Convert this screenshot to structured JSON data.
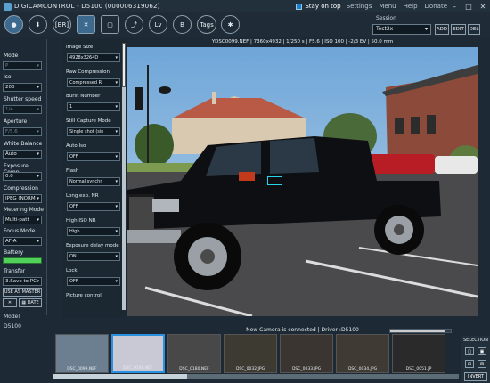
{
  "window": {
    "title": "DIGICAMCONTROL - D5100 (000006319062)",
    "stay_on_top": "Stay on top",
    "menu": [
      "Settings",
      "Menu",
      "Help",
      "Donate"
    ],
    "controls": [
      "–",
      "□",
      "✕"
    ]
  },
  "toolbar": {
    "buttons": [
      {
        "name": "capture-button",
        "label": "●"
      },
      {
        "name": "download-button",
        "label": "⬇"
      },
      {
        "name": "bracketing-button",
        "label": "[BR]"
      },
      {
        "name": "tools-button",
        "label": "✕"
      },
      {
        "name": "browse-button",
        "label": "▢"
      },
      {
        "name": "export-button",
        "label": "⤴"
      },
      {
        "name": "liveview-button",
        "label": "Lv"
      },
      {
        "name": "browser-button",
        "label": "B"
      },
      {
        "name": "tags-button",
        "label": "Tags"
      },
      {
        "name": "plugins-button",
        "label": "✱"
      }
    ],
    "session_label": "Session",
    "session_value": "Test2x",
    "session_buttons": [
      "ADD",
      "EDIT",
      "DEL"
    ]
  },
  "left_panel": {
    "mode_label": "Mode",
    "mode_value": "P",
    "iso_label": "Iso",
    "iso_value": "200",
    "shutter_label": "Shutter speed",
    "shutter_value": "1/4",
    "aperture_label": "Aperture",
    "aperture_value": "F/5.6",
    "wb_label": "White Balance",
    "wb_value": "Auto",
    "exposure_comp_label": "Exposure Comp.",
    "exposure_comp_value": "0.0",
    "compression_label": "Compression",
    "compression_value": "JPEG (NORM",
    "metering_label": "Metering Mode",
    "metering_value": "Multi-patt",
    "focus_label": "Focus Mode",
    "focus_value": "AF-A",
    "battery_label": "Battery",
    "battery_level": 1.0,
    "transfer_label": "Transfer",
    "transfer_value": "3.Save to PC",
    "use_as_master": "USE AS MASTER",
    "date_button": "DATE",
    "model_label": "Model",
    "model_value": "D5100"
  },
  "settings": {
    "items": [
      {
        "label": "Image Size",
        "value": "4928x3264D"
      },
      {
        "label": "Raw Compression",
        "value": "Compressed R"
      },
      {
        "label": "Burst Number",
        "value": "1"
      },
      {
        "label": "Still Capture Mode",
        "value": "Single shot (sin"
      },
      {
        "label": "Auto Iso",
        "value": "OFF"
      },
      {
        "label": "Flash",
        "value": "Normal synchr"
      },
      {
        "label": "Long exp. NR",
        "value": "OFF"
      },
      {
        "label": "High ISO NR",
        "value": "High"
      },
      {
        "label": "Exposure delay mode",
        "value": "ON"
      },
      {
        "label": "Lock",
        "value": "OFF"
      },
      {
        "label": "Picture control",
        "value": ""
      }
    ]
  },
  "viewer": {
    "caption": "YDSC0099.NEF | 7360x4932 | 1/250 s | F5.6 | ISO 100 | -2/3 EV | 50.0 mm"
  },
  "status": {
    "text": "New Camera is connected | Driver :D5100",
    "progress": 0.9
  },
  "thumbnails": [
    {
      "caption": "DSC_0099.NEF",
      "color": "#6b7f90"
    },
    {
      "caption": "DSC_0148.NEF",
      "color": "#c9c9d6"
    },
    {
      "caption": "DSC_0180.NEF",
      "color": "#484848"
    },
    {
      "caption": "DSC_0032.JPG",
      "color": "#3d3a32"
    },
    {
      "caption": "DSC_0033.JPG",
      "color": "#3a3530"
    },
    {
      "caption": "DSC_0034.JPG",
      "color": "#3f3a33"
    },
    {
      "caption": "DSC_0051.JP",
      "color": "#2a2a2a"
    }
  ],
  "selection_panel": {
    "title": "SELECTION",
    "icons": [
      "▢",
      "▣",
      "⊡",
      "⊟"
    ],
    "invert": "INVERT"
  }
}
